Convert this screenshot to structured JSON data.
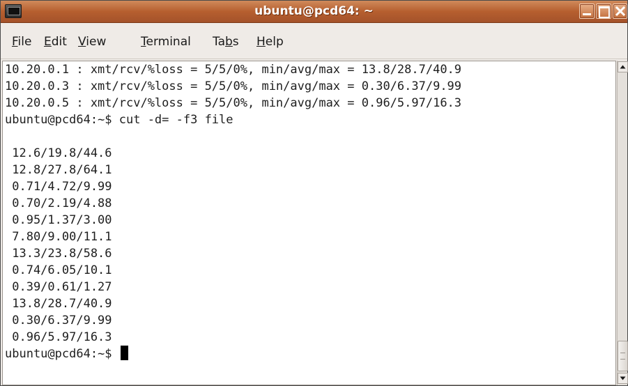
{
  "window": {
    "title": "ubuntu@pcd64: ~"
  },
  "menu": {
    "file": {
      "mnemonic": "F",
      "rest": "ile"
    },
    "edit": {
      "mnemonic": "E",
      "rest": "dit"
    },
    "view": {
      "mnemonic": "V",
      "rest": "iew"
    },
    "terminal": {
      "mnemonic": "T",
      "rest": "erminal"
    },
    "tabs": {
      "pre": "Ta",
      "mnemonic": "b",
      "rest": "s"
    },
    "help": {
      "mnemonic": "H",
      "rest": "elp"
    }
  },
  "terminal": {
    "lines": [
      "10.20.0.1 : xmt/rcv/%loss = 5/5/0%, min/avg/max = 13.8/28.7/40.9",
      "10.20.0.3 : xmt/rcv/%loss = 5/5/0%, min/avg/max = 0.30/6.37/9.99",
      "10.20.0.5 : xmt/rcv/%loss = 5/5/0%, min/avg/max = 0.96/5.97/16.3",
      "ubuntu@pcd64:~$ cut -d= -f3 file",
      "",
      " 12.6/19.8/44.6",
      " 12.8/27.8/64.1",
      " 0.71/4.72/9.99",
      " 0.70/2.19/4.88",
      " 0.95/1.37/3.00",
      " 7.80/9.00/11.1",
      " 13.3/23.8/58.6",
      " 0.74/6.05/10.1",
      " 0.39/0.61/1.27",
      " 13.8/28.7/40.9",
      " 0.30/6.37/9.99",
      " 0.96/5.97/16.3"
    ],
    "prompt": "ubuntu@pcd64:~$ "
  }
}
